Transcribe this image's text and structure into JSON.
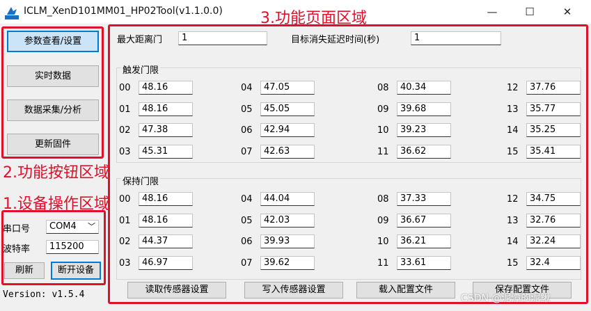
{
  "window": {
    "title": "ICLM_XenD101MM01_HP02Tool(v1.1.0.0)",
    "icon_text": "伽面建",
    "minimize_glyph": "—",
    "maximize_glyph": "☐",
    "close_glyph": "✕"
  },
  "annotations": {
    "device_area": "1.设备操作区域",
    "function_buttons_area": "2.功能按钮区域",
    "function_page_area": "3.功能页面区域"
  },
  "nav": {
    "params": "参数查看/设置",
    "realtime": "实时数据",
    "collect": "数据采集/分析",
    "firmware": "更新固件"
  },
  "device": {
    "port_label": "串口号",
    "port_value": "COM4",
    "baud_label": "波特率",
    "baud_value": "115200",
    "refresh": "刷新",
    "disconnect": "断开设备"
  },
  "version": "Version: v1.5.4",
  "params": {
    "max_distance_label": "最大距离门",
    "max_distance_value": "1",
    "delay_label": "目标消失延迟时间(秒)",
    "delay_value": "1",
    "trigger_title": "触发门限",
    "hold_title": "保持门限",
    "trigger": [
      {
        "gate": "00",
        "value": "48.16"
      },
      {
        "gate": "01",
        "value": "48.16"
      },
      {
        "gate": "02",
        "value": "47.38"
      },
      {
        "gate": "03",
        "value": "45.31"
      },
      {
        "gate": "04",
        "value": "47.05"
      },
      {
        "gate": "05",
        "value": "45.05"
      },
      {
        "gate": "06",
        "value": "42.94"
      },
      {
        "gate": "07",
        "value": "42.63"
      },
      {
        "gate": "08",
        "value": "40.34"
      },
      {
        "gate": "09",
        "value": "39.68"
      },
      {
        "gate": "10",
        "value": "39.23"
      },
      {
        "gate": "11",
        "value": "36.62"
      },
      {
        "gate": "12",
        "value": "37.76"
      },
      {
        "gate": "13",
        "value": "35.77"
      },
      {
        "gate": "14",
        "value": "35.25"
      },
      {
        "gate": "15",
        "value": "35.41"
      }
    ],
    "hold": [
      {
        "gate": "00",
        "value": "48.16"
      },
      {
        "gate": "01",
        "value": "48.16"
      },
      {
        "gate": "02",
        "value": "44.37"
      },
      {
        "gate": "03",
        "value": "46.97"
      },
      {
        "gate": "04",
        "value": "44.04"
      },
      {
        "gate": "05",
        "value": "42.03"
      },
      {
        "gate": "06",
        "value": "39.93"
      },
      {
        "gate": "07",
        "value": "39.62"
      },
      {
        "gate": "08",
        "value": "37.33"
      },
      {
        "gate": "09",
        "value": "36.67"
      },
      {
        "gate": "10",
        "value": "36.21"
      },
      {
        "gate": "11",
        "value": "33.61"
      },
      {
        "gate": "12",
        "value": "34.75"
      },
      {
        "gate": "13",
        "value": "32.76"
      },
      {
        "gate": "14",
        "value": "32.24"
      },
      {
        "gate": "15",
        "value": "32.4"
      }
    ]
  },
  "actions": {
    "read": "读取传感器设置",
    "write": "写入传感器设置",
    "load": "载入配置文件",
    "save": "保存配置文件"
  },
  "watermark": "CSDN @泥潭的泥鳅"
}
